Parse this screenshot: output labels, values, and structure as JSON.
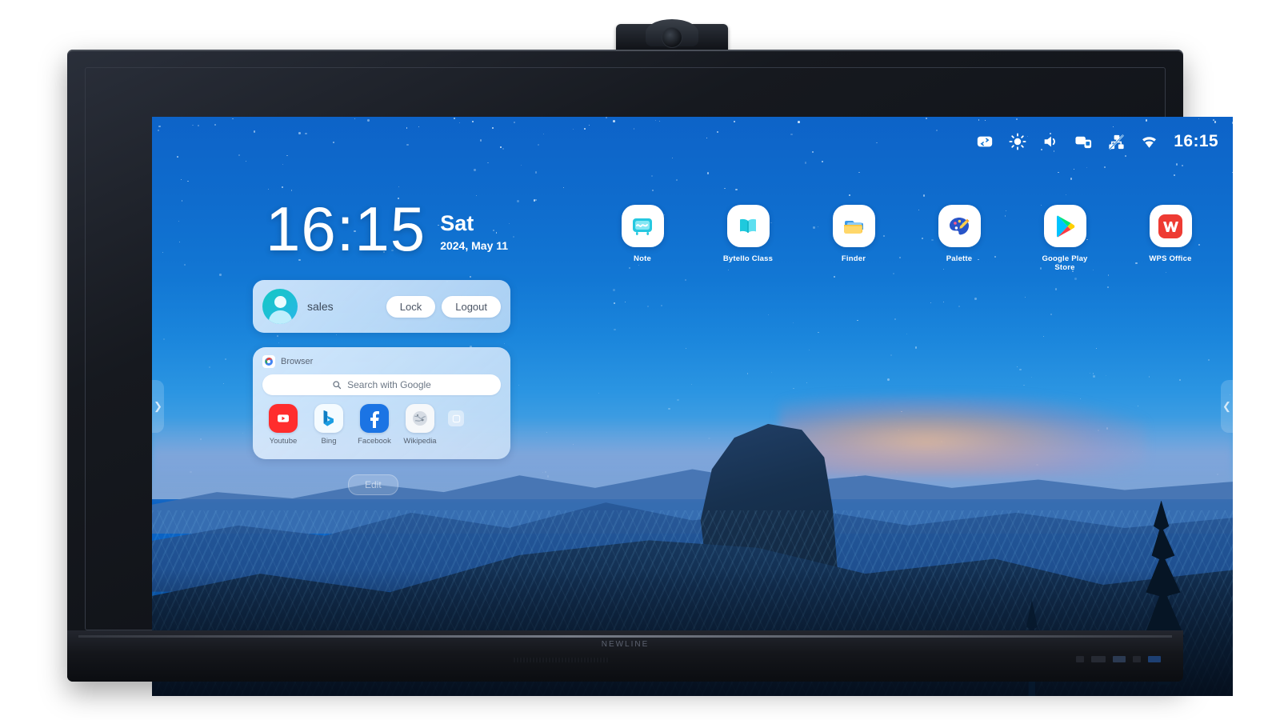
{
  "device": {
    "brand_logo": "NEWLINE",
    "camera": "conference-camera"
  },
  "status_bar": {
    "icons": [
      {
        "name": "input-source-icon",
        "glyph": "input-source"
      },
      {
        "name": "brightness-icon",
        "glyph": "brightness"
      },
      {
        "name": "volume-icon",
        "glyph": "volume"
      },
      {
        "name": "screen-share-icon",
        "glyph": "cast"
      },
      {
        "name": "ethernet-off-icon",
        "glyph": "network-off"
      },
      {
        "name": "wifi-icon",
        "glyph": "wifi"
      }
    ],
    "time": "16:15"
  },
  "clock_widget": {
    "time": "16:15",
    "weekday": "Sat",
    "date": "2024, May 11"
  },
  "user_card": {
    "username": "sales",
    "lock_label": "Lock",
    "logout_label": "Logout"
  },
  "browser_widget": {
    "title": "Browser",
    "search_placeholder": "Search with Google",
    "shortcuts": [
      {
        "label": "Youtube",
        "id": "sc-youtube"
      },
      {
        "label": "Bing",
        "id": "sc-bing"
      },
      {
        "label": "Facebook",
        "id": "sc-facebook"
      },
      {
        "label": "Wikipedia",
        "id": "sc-wikipedia"
      }
    ]
  },
  "edit_button": {
    "label": "Edit"
  },
  "apps": [
    {
      "label": "Note",
      "icon": "note-app-icon"
    },
    {
      "label": "Bytello Class",
      "icon": "bytello-class-app-icon"
    },
    {
      "label": "Finder",
      "icon": "finder-app-icon"
    },
    {
      "label": "Palette",
      "icon": "palette-app-icon"
    },
    {
      "label": "Google Play Store",
      "icon": "play-store-app-icon"
    },
    {
      "label": "WPS Office",
      "icon": "wps-office-app-icon"
    }
  ],
  "side_handles": {
    "left_glyph": "❯",
    "right_glyph": "❮"
  },
  "colors": {
    "sky_blue": "#0f6ccd",
    "accent_white": "#ffffff",
    "avatar_teal": "#13c8c3",
    "youtube_red": "#ff2d2d",
    "facebook_blue": "#1b74e4",
    "wps_red": "#ee3b33"
  }
}
